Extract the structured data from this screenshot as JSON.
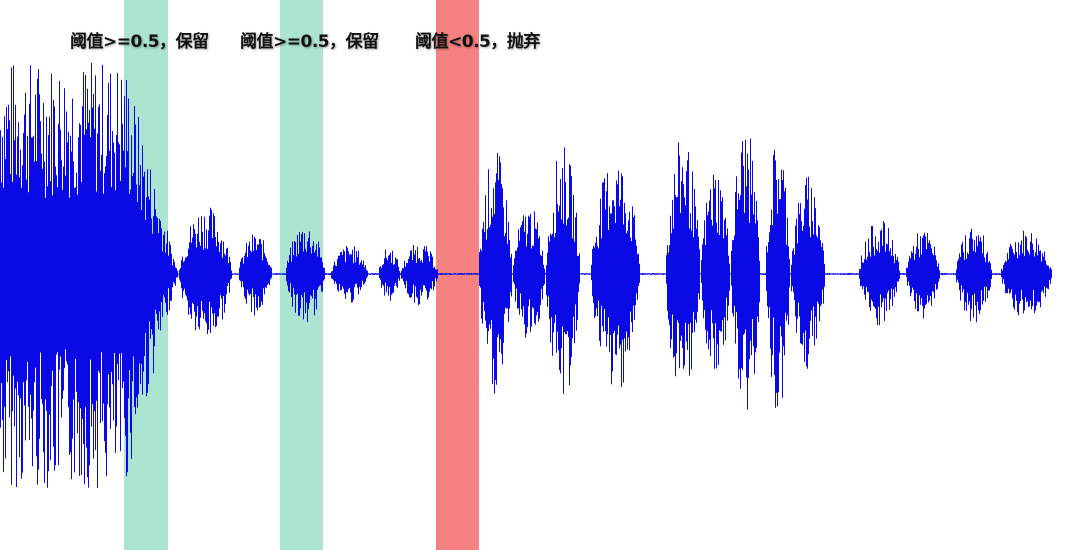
{
  "labels": [
    "阈值>=0.5，保留",
    "阈值>=0.5，保留",
    "阈值<0.5，抛弃"
  ],
  "colors": {
    "waveform": "#0a0ae6",
    "baseline": "#6a6ae8",
    "keep_band": "#a8e4cc",
    "discard_band": "#f57a7a"
  },
  "bands": [
    {
      "label_index": 0,
      "decision": "keep"
    },
    {
      "label_index": 1,
      "decision": "keep"
    },
    {
      "label_index": 2,
      "decision": "discard"
    }
  ]
}
